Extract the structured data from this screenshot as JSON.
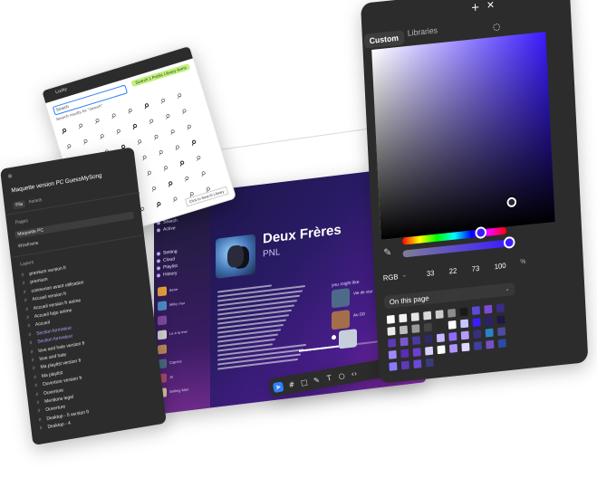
{
  "canvas": {
    "music": {
      "title": "Deux Frères",
      "artist": "PNL",
      "side_items": [
        "Home",
        "Search",
        "Active",
        "Setting",
        "Cloud",
        "Playlist",
        "History"
      ],
      "like_label": "you might like",
      "suggestions": [
        {
          "label": "Vie de star",
          "color": "#4d6a8a"
        },
        {
          "label": "",
          "color": "#43a878"
        },
        {
          "label": "Au DD",
          "color": "#a36f4b"
        },
        {
          "label": "",
          "color": "#5a5a66"
        },
        {
          "label": "",
          "color": "#c6d0da"
        }
      ],
      "queue": [
        {
          "label": "Bene",
          "color": "#e29b3d"
        },
        {
          "label": "Milky mar",
          "color": "#4a8ac6"
        },
        {
          "label": "",
          "color": "#7c4a9d"
        },
        {
          "label": "Le  à la mer",
          "color": "#d0d0d0"
        },
        {
          "label": "",
          "color": "#b88a5a"
        },
        {
          "label": "Caprice",
          "color": "#4a6b7d"
        },
        {
          "label": "Je",
          "color": "#a84a6b"
        },
        {
          "label": "Gelling Man",
          "color": "#d9c6a0"
        }
      ],
      "progress": 0.45
    }
  },
  "toolbar": {
    "tools": [
      "move-icon",
      "frame-icon",
      "shape-icon",
      "pen-icon",
      "text-icon",
      "comment-icon",
      "code-icon"
    ]
  },
  "icon_panel": {
    "file_name": "Lucky",
    "badge": "Search 1 Public Library items",
    "search_value": "Search",
    "result_text": "Search results for \"search\"",
    "tooltip": "Click to Search Library"
  },
  "layers": {
    "file_title": "Maquette version PC GuessMySong",
    "tab_file": "File",
    "tab_assets": "Assets",
    "pages_header": "Pages",
    "pages": [
      "Maquette PC",
      "Wireframe"
    ],
    "layers_header": "Layers",
    "rows": [
      "premium version fr",
      "premium",
      "connexion avant utilisation",
      "Accueil version fr",
      "Accueil version fr anime",
      "Accueil logo anime",
      "Accueil",
      "Section formateur",
      "Section formateur",
      "love and hate version fr",
      "love and hate",
      "Ma playlist version fr",
      "Ma playlist",
      "Ouverture version fr",
      "Ouverture",
      "Mentions legal",
      "Ouverture",
      "Desktop - 5 version fr",
      "Desktop - 4"
    ]
  },
  "picker": {
    "tabs": {
      "custom": "Custom",
      "libraries": "Libraries"
    },
    "model": "RGB",
    "values": [
      "33",
      "22",
      "73",
      "100"
    ],
    "percent_sign": "%",
    "doc_colors_label": "On this page",
    "swatches": [
      "#ffffff",
      "#f2f2f2",
      "#e5e5e5",
      "#d9d9d9",
      "#cccccc",
      "#8c8c8c",
      "#1a1a1a",
      "#5b4bd8",
      "#7b4cd8",
      "#3a2b8a",
      "#eaeaea",
      "#bdbdbd",
      "#9a9a9a",
      "#444444",
      "#2a2a2a",
      "#ffffff",
      "#c7c7ff",
      "#3b1cff",
      "#2b2070",
      "#1f1744",
      "#5c3ab8",
      "#7a59c9",
      "#4a3aa0",
      "#2e2a66",
      "#c9b7ff",
      "#8e6cff",
      "#b69bf7",
      "#3a2f7a",
      "#2a82c9",
      "#4d4d9e",
      "#9f87ff",
      "#5a2db3",
      "#6d3fd1",
      "#d8d0ff",
      "#ffffff",
      "#af95ff",
      "#e0d8ff",
      "#3f3f9e",
      "#7650c8",
      "#2b4ba8",
      "#8a7aff",
      "#5b3bb8",
      "#6a4ad8",
      "#3a3a7a"
    ]
  }
}
